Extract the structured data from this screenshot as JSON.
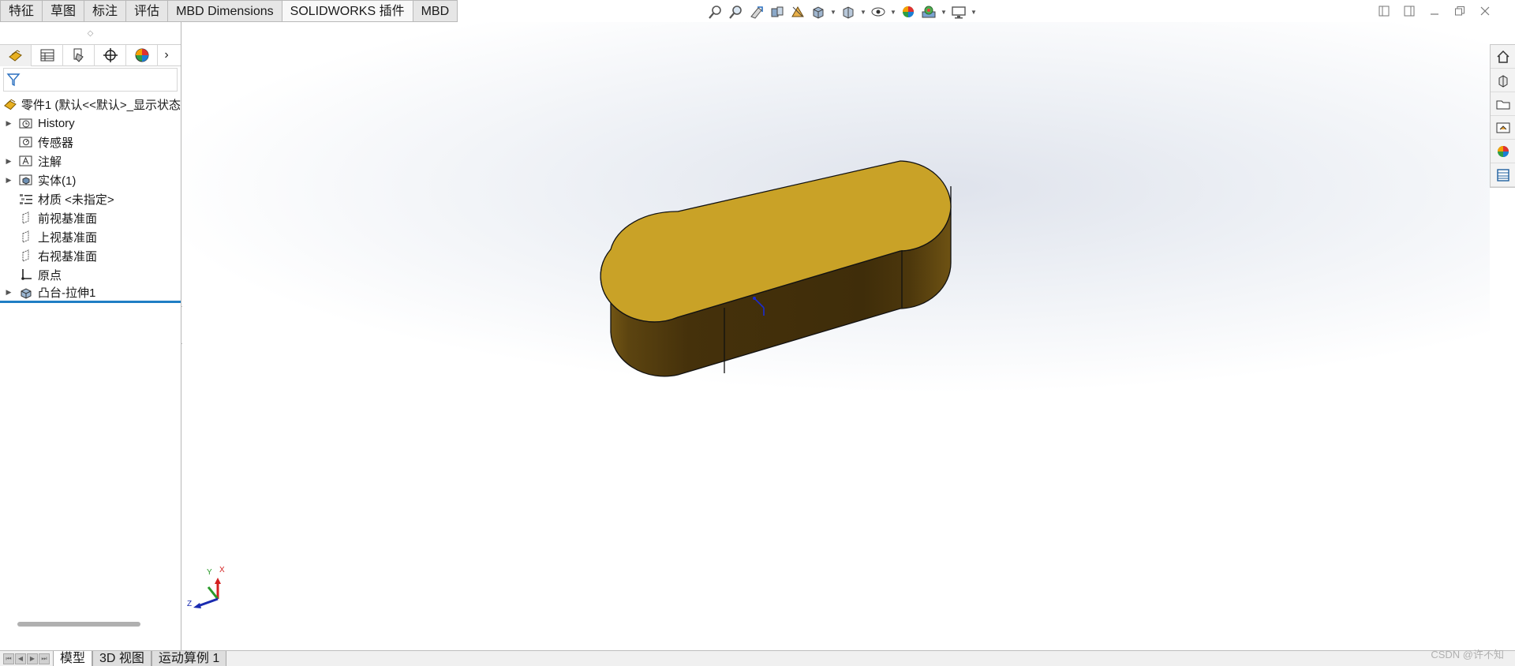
{
  "command_tabs": [
    {
      "label": "特征",
      "active": false
    },
    {
      "label": "草图",
      "active": false
    },
    {
      "label": "标注",
      "active": false
    },
    {
      "label": "评估",
      "active": false
    },
    {
      "label": "MBD Dimensions",
      "active": false
    },
    {
      "label": "SOLIDWORKS 插件",
      "active": true
    },
    {
      "label": "MBD",
      "active": false
    }
  ],
  "heads_up_toolbar": [
    "zoom-to-fit-icon",
    "zoom-to-area-icon",
    "previous-view-icon",
    "section-view-icon",
    "dynamic-annotation-icon",
    "view-orientation-icon",
    "display-style-icon",
    "hide-show-items-icon",
    "edit-appearance-icon",
    "apply-scene-icon",
    "view-settings-icon"
  ],
  "manager_tabs": [
    "featuremanager-icon",
    "propertymanager-icon",
    "configurationmanager-icon",
    "dimxpertmanager-icon",
    "displaymanager-icon"
  ],
  "tree": {
    "root_label": "零件1  (默认<<默认>_显示状态",
    "items": [
      {
        "label": "History",
        "icon": "history-folder-icon",
        "expandable": true
      },
      {
        "label": "传感器",
        "icon": "sensor-icon",
        "expandable": false
      },
      {
        "label": "注解",
        "icon": "annotations-icon",
        "expandable": true
      },
      {
        "label": "实体(1)",
        "icon": "solid-bodies-icon",
        "expandable": true
      },
      {
        "label": "材质 <未指定>",
        "icon": "material-icon",
        "expandable": false
      },
      {
        "label": "前视基准面",
        "icon": "plane-icon",
        "expandable": false
      },
      {
        "label": "上视基准面",
        "icon": "plane-icon",
        "expandable": false
      },
      {
        "label": "右视基准面",
        "icon": "plane-icon",
        "expandable": false
      },
      {
        "label": "原点",
        "icon": "origin-icon",
        "expandable": false
      },
      {
        "label": "凸台-拉伸1",
        "icon": "boss-extrude-icon",
        "expandable": true
      }
    ]
  },
  "triad": {
    "x": "X",
    "y": "Y",
    "z": "Z"
  },
  "bottom_tabs": [
    {
      "label": "模型",
      "active": true
    },
    {
      "label": "3D 视图",
      "active": false
    },
    {
      "label": "运动算例 1",
      "active": false
    }
  ],
  "watermark": "CSDN @许不知",
  "colors": {
    "part_top": "#c9a227",
    "part_side_dark": "#45310b",
    "part_side_light": "#7a5c17",
    "accent": "#1f7ec4"
  }
}
